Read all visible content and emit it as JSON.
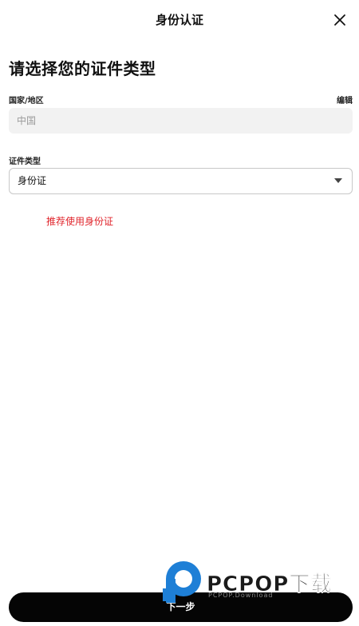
{
  "header": {
    "title": "身份认证",
    "close_icon": "close-icon"
  },
  "main": {
    "heading": "请选择您的证件类型",
    "country": {
      "label": "国家/地区",
      "edit_label": "编辑",
      "value": "中国"
    },
    "id_type": {
      "label": "证件类型",
      "selected": "身份证",
      "caret_icon": "caret-down-icon"
    },
    "hint": "推荐使用身份证"
  },
  "footer": {
    "next_label": "下一步"
  },
  "watermark": {
    "brand": "PCPOP下载",
    "sub": "PCPOP.Download"
  },
  "colors": {
    "accent_red": "#e0252c",
    "button_bg": "#050505",
    "field_bg": "#f2f2f2",
    "watermark_blue": "#1e7fd6"
  }
}
